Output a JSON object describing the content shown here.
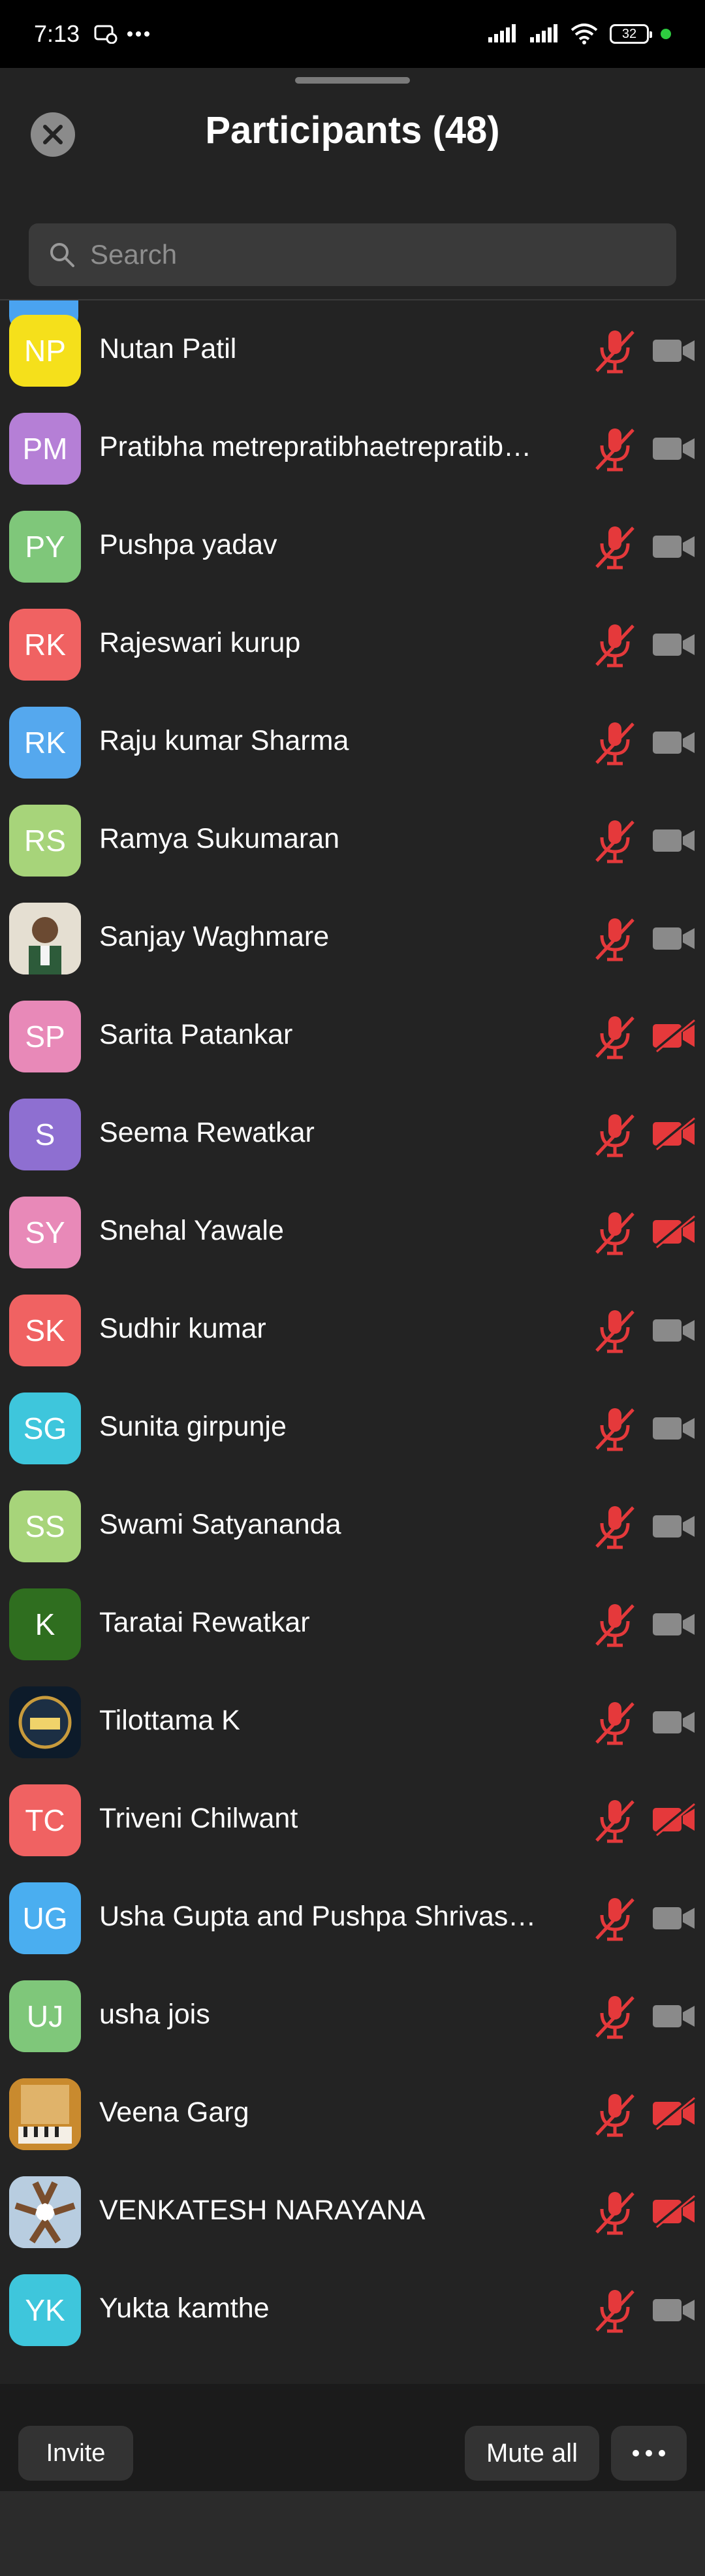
{
  "status_bar": {
    "time": "7:13",
    "battery": "32",
    "icons": [
      "notification-icon",
      "more-dots-icon",
      "signal-icon",
      "signal-icon",
      "wifi-icon",
      "battery-icon"
    ],
    "privacy_dot_color": "#2ecc40"
  },
  "header": {
    "title": "Participants (48)",
    "close_icon": "close-icon"
  },
  "search": {
    "placeholder": "Search",
    "value": ""
  },
  "participants": [
    {
      "initials": "NP",
      "name": "Nutan Patil",
      "color": "#f5e01b",
      "mic": "muted",
      "video": "off"
    },
    {
      "initials": "PM",
      "name": "Pratibha metrepratibhaetrepratib…",
      "color": "#b57fd6",
      "mic": "muted",
      "video": "off"
    },
    {
      "initials": "PY",
      "name": "Pushpa yadav",
      "color": "#7fc77a",
      "mic": "muted",
      "video": "off"
    },
    {
      "initials": "RK",
      "name": "Rajeswari kurup",
      "color": "#f06262",
      "mic": "muted",
      "video": "off"
    },
    {
      "initials": "RK",
      "name": "Raju kumar Sharma",
      "color": "#55a8ee",
      "mic": "muted",
      "video": "off"
    },
    {
      "initials": "RS",
      "name": "Ramya Sukumaran",
      "color": "#a7d47a",
      "mic": "muted",
      "video": "off"
    },
    {
      "initials": "",
      "name": "Sanjay Waghmare",
      "color": "#d9d2c4",
      "avatar_icon": "profile-photo",
      "mic": "muted",
      "video": "off"
    },
    {
      "initials": "SP",
      "name": "Sarita Patankar",
      "color": "#e889b8",
      "mic": "muted",
      "video": "disabled"
    },
    {
      "initials": "S",
      "name": "Seema  Rewatkar",
      "color": "#8e6fd1",
      "mic": "muted",
      "video": "disabled"
    },
    {
      "initials": "SY",
      "name": "Snehal Yawale",
      "color": "#e889b8",
      "mic": "muted",
      "video": "disabled"
    },
    {
      "initials": "SK",
      "name": "Sudhir kumar",
      "color": "#f06262",
      "mic": "muted",
      "video": "off"
    },
    {
      "initials": "SG",
      "name": "Sunita girpunje",
      "color": "#3ec6dc",
      "mic": "muted",
      "video": "off"
    },
    {
      "initials": "SS",
      "name": "Swami Satyananda",
      "color": "#a7d47a",
      "mic": "muted",
      "video": "off"
    },
    {
      "initials": "K",
      "name": "Taratai Rewatkar",
      "color": "#2f6e1f",
      "mic": "muted",
      "video": "off"
    },
    {
      "initials": "",
      "name": "Tilottama K",
      "color": "#0d1b2a",
      "avatar_icon": "l4-badge-photo",
      "mic": "muted",
      "video": "off"
    },
    {
      "initials": "TC",
      "name": "Triveni Chilwant",
      "color": "#f06262",
      "mic": "muted",
      "video": "disabled"
    },
    {
      "initials": "UG",
      "name": "Usha Gupta and Pushpa Shrivast…",
      "color": "#4aaef0",
      "mic": "muted",
      "video": "off"
    },
    {
      "initials": "UJ",
      "name": "usha jois",
      "color": "#7fc77a",
      "mic": "muted",
      "video": "off"
    },
    {
      "initials": "",
      "name": "Veena Garg",
      "color": "#c98a2e",
      "avatar_icon": "harmonium-photo",
      "mic": "muted",
      "video": "disabled"
    },
    {
      "initials": "",
      "name": "VENKATESH NARAYANA",
      "color": "#9fb6cf",
      "avatar_icon": "group-hands-photo",
      "mic": "muted",
      "video": "disabled"
    },
    {
      "initials": "YK",
      "name": "Yukta kamthe",
      "color": "#3ec6dc",
      "mic": "muted",
      "video": "off"
    }
  ],
  "footer": {
    "invite_label": "Invite",
    "mute_all_label": "Mute all",
    "more_icon": "more-horizontal-icon"
  },
  "colors": {
    "muted_red": "#e5393b",
    "camera_gray": "#8a8a8a",
    "background": "#232323"
  }
}
